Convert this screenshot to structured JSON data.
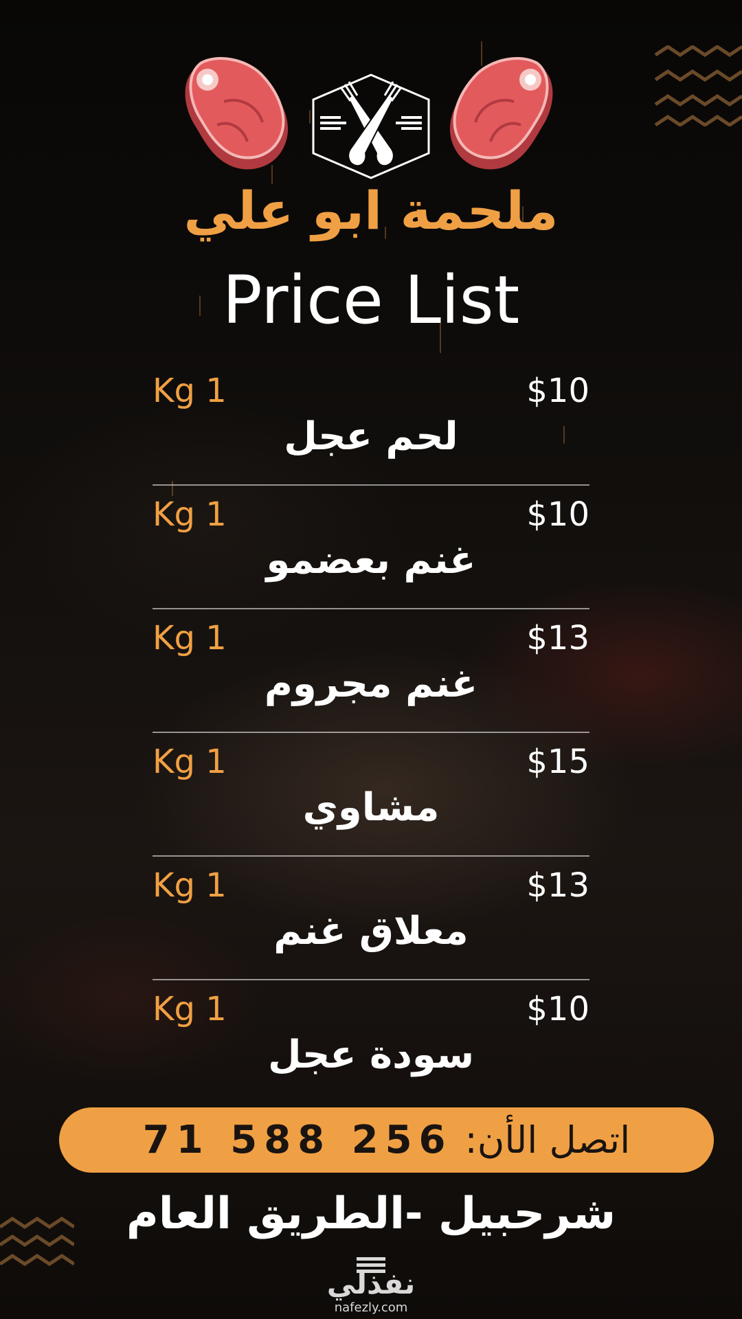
{
  "header": {
    "shop_name": "ملحمة ابو علي",
    "title": "Price List"
  },
  "icons": {
    "steak_left": "steak-icon",
    "logo": "fork-cross-hexagon-icon",
    "steak_right": "steak-icon"
  },
  "items": [
    {
      "qty": "Kg 1",
      "price": "$10",
      "name": "لحم عجل"
    },
    {
      "qty": "Kg 1",
      "price": "$10",
      "name": "غنم بعضمو"
    },
    {
      "qty": "Kg 1",
      "price": "$13",
      "name": "غنم مجروم"
    },
    {
      "qty": "Kg 1",
      "price": "$15",
      "name": "مشاوي"
    },
    {
      "qty": "Kg 1",
      "price": "$13",
      "name": "معلاق غنم"
    },
    {
      "qty": "Kg 1",
      "price": "$10",
      "name": "سودة عجل"
    }
  ],
  "contact": {
    "label": "اتصل الأن:",
    "number": "71 588 256"
  },
  "address": "شرحبيل -الطريق العام",
  "watermark": {
    "name": "نفذلي",
    "url": "nafezly.com"
  },
  "colors": {
    "accent": "#f0a044",
    "background": "#0b0a09",
    "text": "#ffffff",
    "steak": "#e0565a"
  }
}
